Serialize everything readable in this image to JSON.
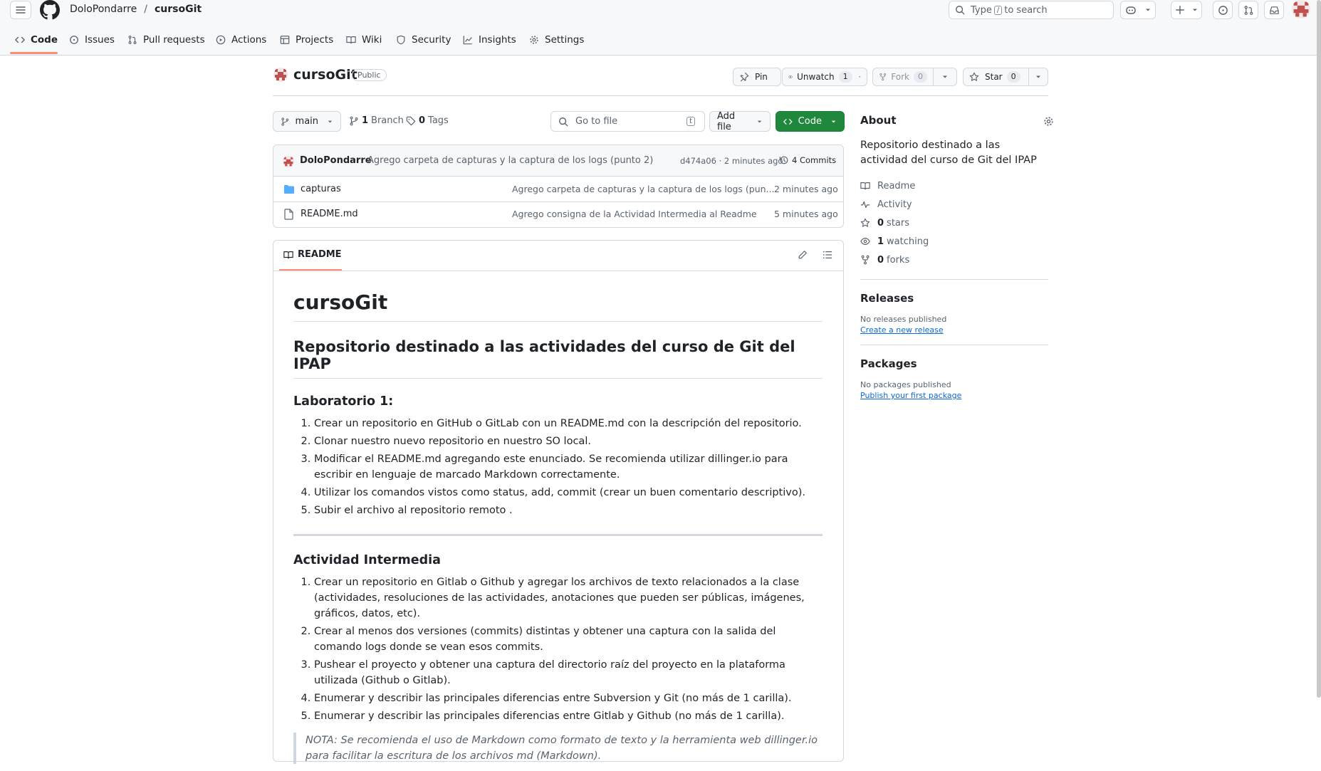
{
  "header": {
    "owner": "DoloPondarre",
    "separator": "/",
    "repo": "cursoGit",
    "search_prefix": "Type",
    "search_key": "/",
    "search_suffix": "to search"
  },
  "tabs": [
    {
      "label": "Code"
    },
    {
      "label": "Issues"
    },
    {
      "label": "Pull requests"
    },
    {
      "label": "Actions"
    },
    {
      "label": "Projects"
    },
    {
      "label": "Wiki"
    },
    {
      "label": "Security"
    },
    {
      "label": "Insights"
    },
    {
      "label": "Settings"
    }
  ],
  "repo": {
    "name": "cursoGit",
    "visibility": "Public",
    "pin_label": "Pin",
    "unwatch_label": "Unwatch",
    "unwatch_count": "1",
    "fork_label": "Fork",
    "fork_count": "0",
    "star_label": "Star",
    "star_count": "0"
  },
  "controls": {
    "branch": "main",
    "branch_count": "1",
    "branch_label": "Branch",
    "tags_count": "0",
    "tags_label": "Tags",
    "goto_placeholder": "Go to file",
    "goto_key": "t",
    "add_file": "Add file",
    "code": "Code"
  },
  "commit": {
    "author": "DoloPondarre",
    "message": "Agrego carpeta de capturas y la captura de los logs (punto 2)",
    "hash_time": "d474a06 · 2 minutes ago",
    "commits": "4 Commits"
  },
  "files": [
    {
      "name": "capturas",
      "type": "folder",
      "message": "Agrego carpeta de capturas y la captura de los logs (pun...",
      "time": "2 minutes ago"
    },
    {
      "name": "README.md",
      "type": "file",
      "message": "Agrego consigna de la Actividad Intermedia al Readme",
      "time": "5 minutes ago"
    }
  ],
  "readme": {
    "tab_label": "README",
    "h1": "cursoGit",
    "h2": "Repositorio destinado a las actividades del curso de Git del IPAP",
    "lab_title": "Laboratorio 1:",
    "lab_items": [
      "Crear un repositorio en GitHub o GitLab con un README.md con la descripción del repositorio.",
      "Clonar nuestro nuevo repositorio en nuestro SO local.",
      "Modificar el README.md agregando este enunciado. Se recomienda utilizar dillinger.io para escribir en lenguaje de marcado Markdown correctamente.",
      "Utilizar los comandos vistos como status, add, commit (crear un buen comentario descriptivo).",
      "Subir el archivo al repositorio remoto ."
    ],
    "act_title": "Actividad Intermedia",
    "act_items": [
      "Crear un repositorio en Gitlab o Github y agregar los archivos de texto relacionados a la clase (actividades, resoluciones de las actividades, anotaciones que pueden ser públicas, imágenes, gráficos, datos, etc).",
      "Crear al menos dos versiones (commits) distintas y obtener una captura con la salida del comando logs donde se vean esos commits.",
      "Pushear el proyecto y obtener una captura del directorio raíz del proyecto en la plataforma utilizada (Github o Gitlab).",
      "Enumerar y describir las principales diferencias entre Subversion y Git (no más de 1 carilla).",
      "Enumerar y describir las principales diferencias entre Gitlab y Github (no más de 1 carilla)."
    ],
    "note": "NOTA: Se recomienda el uso de Markdown como formato de texto y la herramienta web dillinger.io para facilitar la escritura de los archivos md (Markdown)."
  },
  "about": {
    "title": "About",
    "description": "Repositorio destinado a las actividad del curso de Git del IPAP",
    "readme": "Readme",
    "activity": "Activity",
    "stars_count": "0",
    "stars_label": "stars",
    "watching_count": "1",
    "watching_label": "watching",
    "forks_count": "0",
    "forks_label": "forks"
  },
  "releases": {
    "title": "Releases",
    "none": "No releases published",
    "link": "Create a new release"
  },
  "packages": {
    "title": "Packages",
    "none": "No packages published",
    "link": "Publish your first package"
  },
  "colors": {
    "accent_green": "#1f883d",
    "tab_underline": "#fd8c73",
    "link_blue": "#0969da",
    "folder_blue": "#54aeff"
  }
}
